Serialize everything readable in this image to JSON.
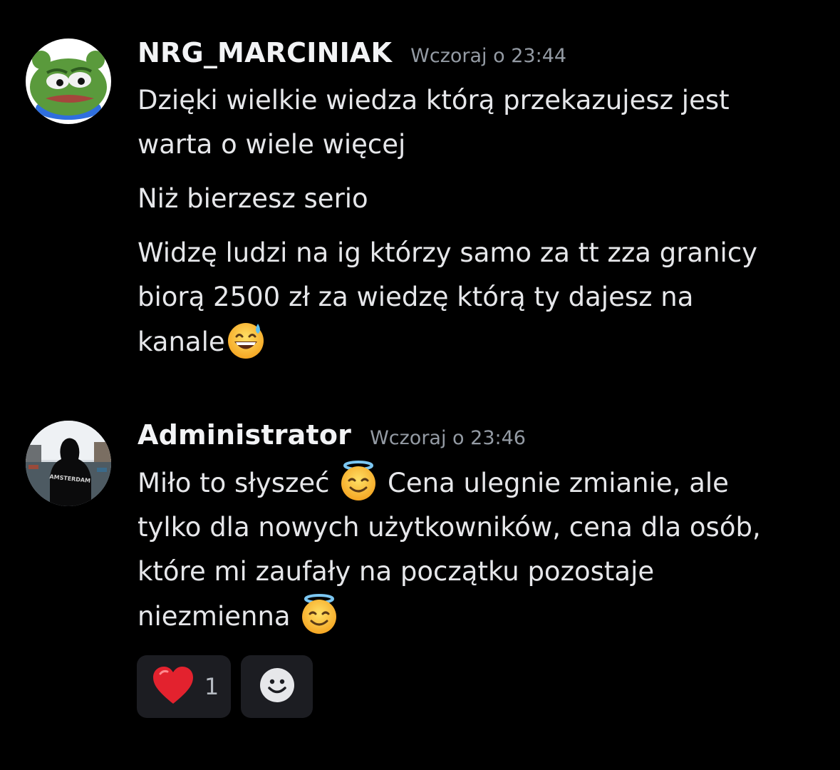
{
  "messages": [
    {
      "author": "NRG_MARCINIAK",
      "timestamp": "Wczoraj o 23:44",
      "avatar": "pepe-frog-avatar",
      "paragraphs": [
        {
          "lines": [
            "Dzięki wielkie wiedza którą przekazujesz jest",
            "warta o wiele więcej"
          ]
        },
        {
          "lines": [
            "Niż bierzesz serio"
          ]
        },
        {
          "lines": [
            "Widzę ludzi na ig którzy samo za tt zza granicy",
            "biorą 2500 zł za wiedzę którą ty dajesz na",
            "kanale"
          ]
        }
      ],
      "emoji": "grinning-face-with-sweat"
    },
    {
      "author": "Administrator",
      "timestamp": "Wczoraj o 23:46",
      "avatar": "hooded-person-amsterdam-avatar",
      "avatar_text": "AMSTERDAM",
      "lines": {
        "l1a": "Miło to słyszeć ",
        "l1b": " Cena ulegnie zmianie, ale",
        "l2": "tylko dla nowych użytkowników, cena dla osób,",
        "l3": "które mi zaufały na początku pozostaje",
        "l4": "niezmienna "
      },
      "emoji": "smiling-face-with-halo",
      "reactions": [
        {
          "icon": "red-heart",
          "count": "1"
        },
        {
          "icon": "add-reaction-smiley"
        }
      ]
    }
  ],
  "colors": {
    "background": "#000000",
    "username": "#f2f3f5",
    "timestamp": "#949ba4",
    "text": "#e6e7ea",
    "reaction_bg": "#1c1d22"
  }
}
